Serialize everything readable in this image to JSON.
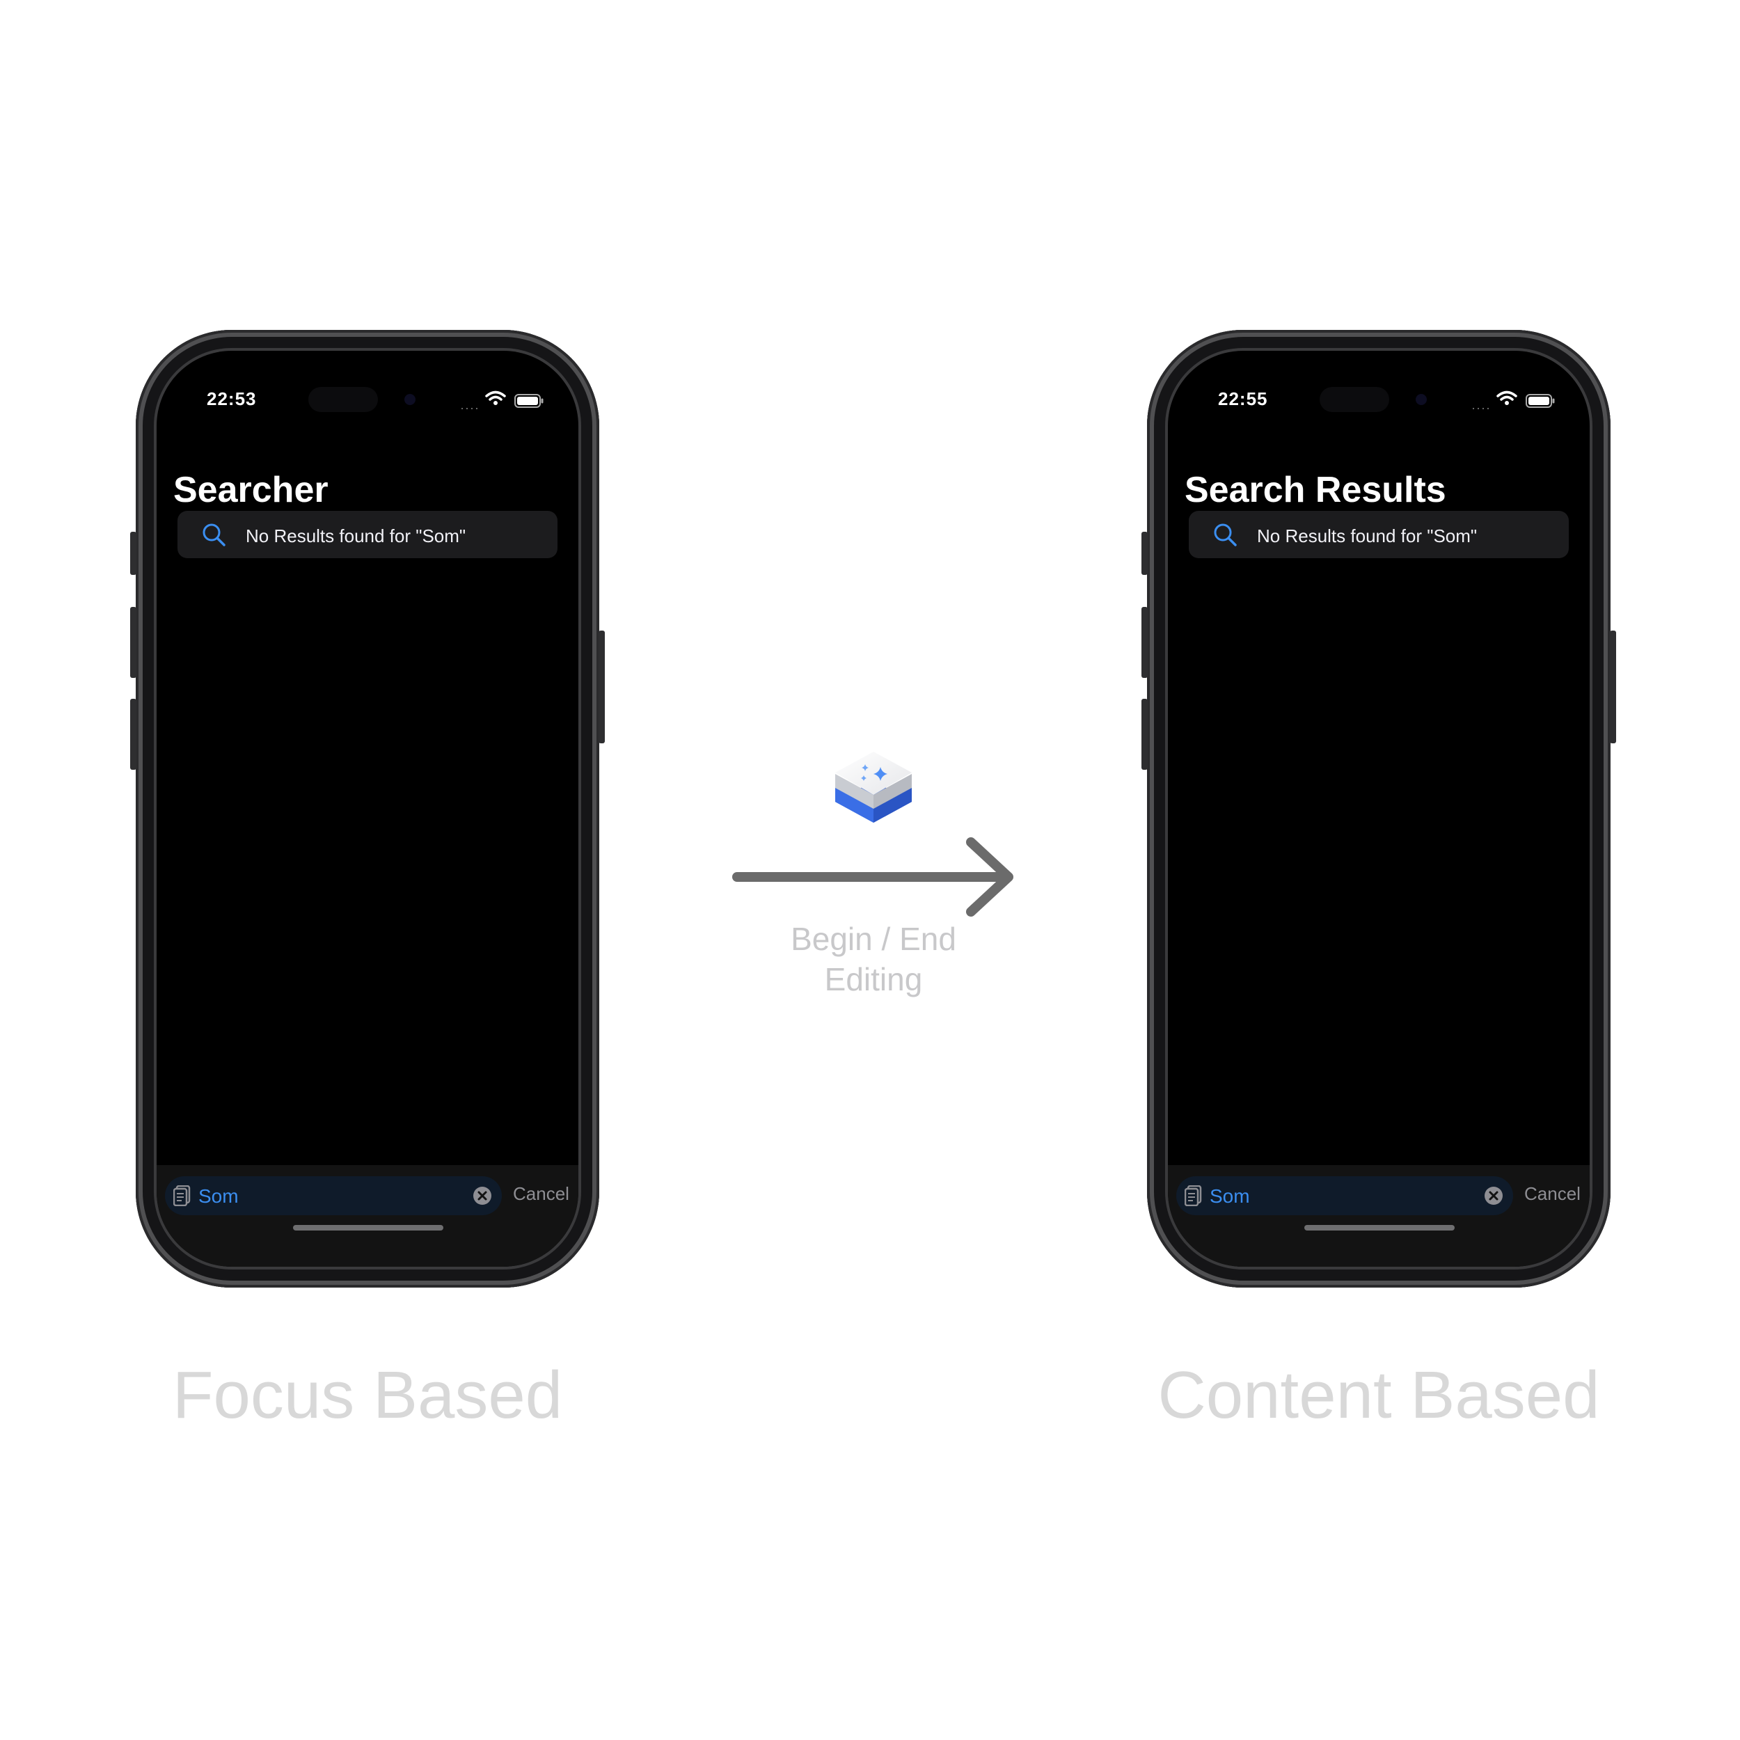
{
  "left_phone": {
    "status_time": "22:53",
    "title": "Searcher",
    "notice": "No Results found for \"Som\"",
    "search_value": "Som",
    "cancel_label": "Cancel"
  },
  "right_phone": {
    "status_time": "22:55",
    "title": "Search Results",
    "notice": "No Results found for \"Som\"",
    "search_value": "Som",
    "cancel_label": "Cancel"
  },
  "transition": {
    "label_line1": "Begin / End",
    "label_line2": "Editing"
  },
  "captions": {
    "left": "Focus Based",
    "right": "Content Based"
  },
  "colors": {
    "accent": "#3b8ef0",
    "screen_bg": "#000000",
    "caption": "#d8d8d8"
  },
  "icons": [
    "search-icon",
    "document-icon",
    "clear-icon",
    "wifi-icon",
    "battery-icon",
    "sparkle-app-icon",
    "arrow-right-icon"
  ]
}
